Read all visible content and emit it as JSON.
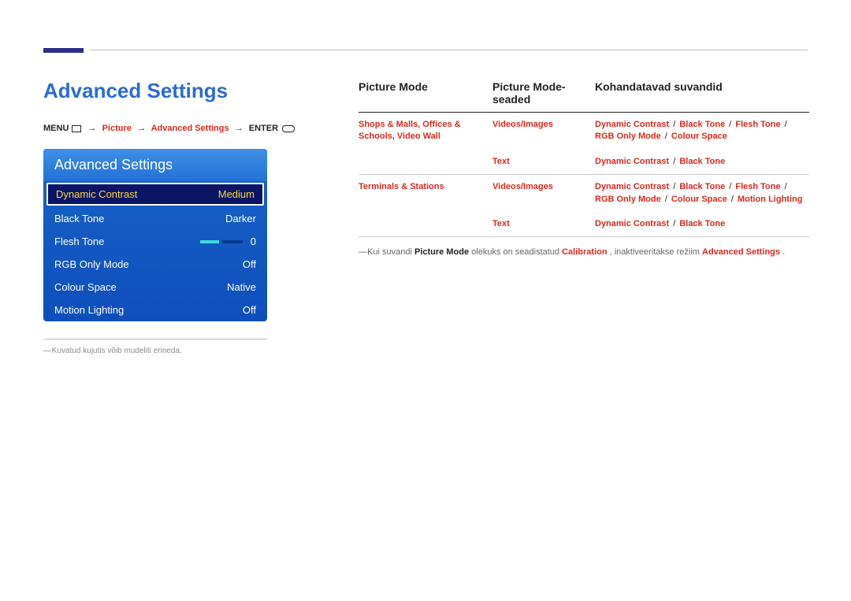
{
  "heading": "Advanced Settings",
  "menu_path": {
    "menu": "MENU",
    "arrow": "→",
    "p1": "Picture",
    "p2": "Advanced Settings",
    "enter": "ENTER"
  },
  "panel": {
    "title": "Advanced Settings",
    "rows": [
      {
        "label": "Dynamic Contrast",
        "value": "Medium",
        "selected": true
      },
      {
        "label": "Black Tone",
        "value": "Darker"
      },
      {
        "label": "Flesh Tone",
        "value": "0",
        "slider": true
      },
      {
        "label": "RGB Only Mode",
        "value": "Off"
      },
      {
        "label": "Colour Space",
        "value": "Native"
      },
      {
        "label": "Motion Lighting",
        "value": "Off"
      }
    ]
  },
  "footnote_left": "Kuvatud kujutis võib mudeliti erineda.",
  "table": {
    "headers": [
      "Picture Mode",
      "Picture Mode-seaded",
      "Kohandatavad suvandid"
    ],
    "rows": [
      {
        "c1": "Shops & Malls, Offices & Schools, Video Wall",
        "c2": "Videos/Images",
        "c3_parts": [
          "Dynamic Contrast",
          "Black Tone",
          "Flesh Tone",
          "RGB Only Mode",
          "Colour Space"
        ],
        "bottom": false
      },
      {
        "c1": "",
        "c2": "Text",
        "c3_parts": [
          "Dynamic Contrast",
          "Black Tone"
        ],
        "bottom": true
      },
      {
        "c1": "Terminals & Stations",
        "c2": "Videos/Images",
        "c3_parts": [
          "Dynamic Contrast",
          "Black Tone",
          "Flesh Tone",
          "RGB Only Mode",
          "Colour Space",
          "Motion Lighting"
        ],
        "bottom": false
      },
      {
        "c1": "",
        "c2": "Text",
        "c3_parts": [
          "Dynamic Contrast",
          "Black Tone"
        ],
        "bottom": true
      }
    ]
  },
  "right_note": {
    "dash": "―",
    "t1": "Kui suvandi ",
    "b1": "Picture Mode",
    "t2": " olekuks on seadistatud ",
    "r1": "Calibration",
    "t3": ", inaktiveeritakse režiim ",
    "r2": "Advanced Settings",
    "t4": "."
  }
}
